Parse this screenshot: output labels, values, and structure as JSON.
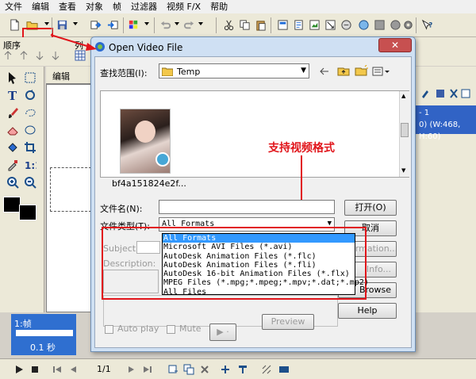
{
  "menubar": {
    "items": [
      "文件",
      "编辑",
      "查看",
      "对象",
      "帧",
      "过滤器",
      "视频 F/X",
      "帮助"
    ]
  },
  "toolbar2": {
    "order_label": "顺序",
    "partial_label": "列"
  },
  "canvas": {
    "tab_label": "编辑"
  },
  "right_panel": {
    "line1": "- 1",
    "line2": "0) (W:468, H:60)"
  },
  "frame_panel": {
    "frame_label": "1:帧",
    "time_label": "0.1 秒"
  },
  "playbar": {
    "page_label": "1/1"
  },
  "dialog": {
    "title": "Open Video File",
    "look_in_label": "查找范围(I):",
    "look_in_value": "Temp",
    "file_thumb_name": "bf4a151824e2f...",
    "file_name_label": "文件名(N):",
    "file_name_value": "",
    "file_type_label": "文件类型(T):",
    "file_type_value": "All Formats",
    "open_button": "打开(O)",
    "cancel_button": "取消",
    "subject_label": "Subject:",
    "description_label": "Description:",
    "information_button": "Information...",
    "info_button": "Info...",
    "browse_button": "Browse",
    "help_button": "Help",
    "preview_button": "Preview",
    "autoplay_label": "Auto play",
    "mute_label": "Mute",
    "annotation": "支持视频格式",
    "file_types": [
      "All Formats",
      "Microsoft AVI Files (*.avi)",
      "AutoDesk Animation Files (*.flc)",
      "AutoDesk Animation Files (*.fli)",
      "AutoDesk 16-bit Animation Files (*.flx)",
      "MPEG Files (*.mpg;*.mpeg;*.mpv;*.dat;*.mp2)",
      "All Files"
    ],
    "selected_file_type_index": 0
  },
  "colors": {
    "highlight_red": "#e1151b",
    "selection_blue": "#3399ff",
    "panel_blue": "#2f6fd0"
  }
}
